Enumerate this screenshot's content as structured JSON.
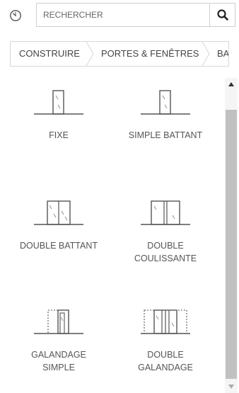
{
  "toolbar": {
    "clock_icon": "clock-icon",
    "search_placeholder": "RECHERCHER",
    "search_icon": "search-icon"
  },
  "breadcrumb": {
    "items": [
      {
        "label": "CONSTRUIRE"
      },
      {
        "label": "PORTES & FENÊTRES"
      },
      {
        "label": "BA"
      }
    ]
  },
  "items": [
    {
      "label": "FIXE",
      "icon": "fixed-window-icon"
    },
    {
      "label": "SIMPLE BATTANT",
      "icon": "single-hinged-door-icon"
    },
    {
      "label": "DOUBLE BATTANT",
      "icon": "double-hinged-door-icon"
    },
    {
      "label": "DOUBLE\nCOULISSANTE",
      "icon": "double-sliding-door-icon"
    },
    {
      "label": "GALANDAGE\nSIMPLE",
      "icon": "single-pocket-door-icon"
    },
    {
      "label": "DOUBLE\nGALANDAGE",
      "icon": "double-pocket-door-icon"
    }
  ]
}
